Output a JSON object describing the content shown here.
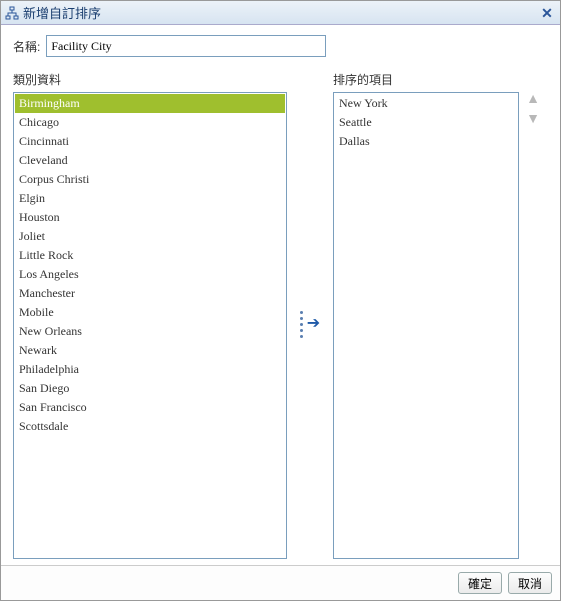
{
  "titlebar": {
    "title": "新增自訂排序"
  },
  "name": {
    "label": "名稱:",
    "value": "Facility City"
  },
  "source": {
    "label": "類別資料",
    "items": [
      "Birmingham",
      "Chicago",
      "Cincinnati",
      "Cleveland",
      "Corpus Christi",
      "Elgin",
      "Houston",
      "Joliet",
      "Little Rock",
      "Los Angeles",
      "Manchester",
      "Mobile",
      "New Orleans",
      "Newark",
      "Philadelphia",
      "San Diego",
      "San Francisco",
      "Scottsdale"
    ],
    "selected_index": 0
  },
  "target": {
    "label": "排序的項目",
    "items": [
      "New York",
      "Seattle",
      "Dallas"
    ]
  },
  "buttons": {
    "ok": "確定",
    "cancel": "取消"
  }
}
